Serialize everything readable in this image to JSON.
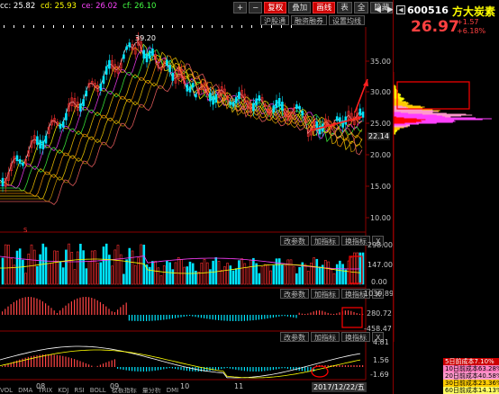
{
  "ma_legend": [
    {
      "text": "cc: 25.82",
      "color": "#ffffff"
    },
    {
      "text": "cd: 25.93",
      "color": "#ffff00"
    },
    {
      "text": "ce: 26.02",
      "color": "#ff40ff"
    },
    {
      "text": "cf: 26.10",
      "color": "#40ff40"
    }
  ],
  "toolbar": {
    "plus": "+",
    "minus": "−",
    "rights": "复权",
    "overlay": "叠加",
    "draw": "画线",
    "table": "表",
    "close_all": "全",
    "hide": "隐藏",
    "arrow_left": "◀",
    "arrow_right": "▶"
  },
  "subbar": {
    "shanghai": "沪股通",
    "margin": "融资融券",
    "ma_setting": "设置均线"
  },
  "stock": {
    "code": "600516",
    "name": "方大炭素",
    "price": "26.97",
    "change": "+1.57",
    "change_pct": "+6.18%"
  },
  "price_scale": [
    "35.00",
    "30.00",
    "25.00",
    "22.14",
    "20.00",
    "15.00",
    "10.00"
  ],
  "peak_label": "39.20",
  "panel_buttons": {
    "params": "改参数",
    "add_index": "加指标",
    "switch_index": "换指标",
    "close": "X"
  },
  "vol_scale": [
    "298.00",
    "147.00",
    "0.00"
  ],
  "macd_scale": [
    "1039.89",
    "280.72",
    "-458.47"
  ],
  "kdj_scale": [
    "4.81",
    "1.56",
    "-1.69"
  ],
  "time_axis": [
    "08",
    "09",
    "10",
    "11",
    "2017/12/22/五"
  ],
  "bottom_tabs": [
    "VOL",
    "DMA",
    "TRIX",
    "KDJ",
    "RSI",
    "BOLL",
    "模板指标",
    "量分析",
    "DMI"
  ],
  "cost_list": [
    {
      "text": "5日前成本7.10%",
      "bg": "#cc0000"
    },
    {
      "text": "10日前成本63.28%",
      "bg": "#ff7fbf"
    },
    {
      "text": "20日前成本40.58%",
      "bg": "#ff99cc"
    },
    {
      "text": "30日前成本23.36%",
      "bg": "#ffcc00"
    },
    {
      "text": "60日前成本14.13%",
      "bg": "#ffff66"
    }
  ],
  "colors": {
    "up": "#ff3030",
    "down": "#00e5ff",
    "bg": "#000000",
    "accent": "#ff0000"
  }
}
